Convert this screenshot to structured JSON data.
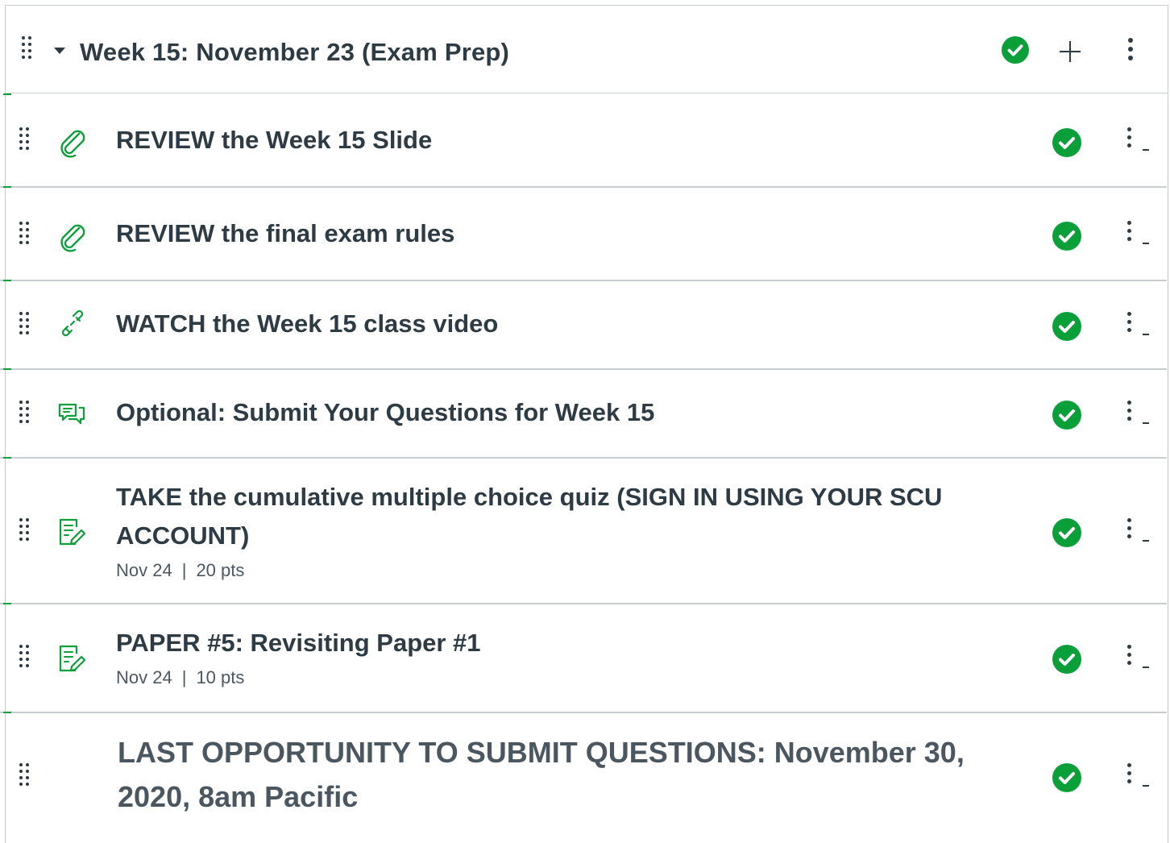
{
  "module": {
    "title": "Week 15: November 23 (Exam Prep)",
    "published": true,
    "collapse_icon": "caret-down-icon",
    "add_icon": "plus-icon",
    "menu_icon": "kebab-icon"
  },
  "items": [
    {
      "type": "file",
      "icon": "paperclip-icon",
      "title": "REVIEW the Week 15 Slide",
      "published": true
    },
    {
      "type": "file",
      "icon": "paperclip-icon",
      "title": "REVIEW the final exam rules",
      "published": true
    },
    {
      "type": "link",
      "icon": "link-icon",
      "title": "WATCH the Week 15 class video",
      "published": true
    },
    {
      "type": "discussion",
      "icon": "discussion-icon",
      "title": "Optional: Submit Your Questions for Week 15",
      "published": true
    },
    {
      "type": "assignment",
      "icon": "assignment-icon",
      "title": "TAKE the cumulative multiple choice quiz (SIGN IN USING YOUR SCU ACCOUNT)",
      "due": "Nov 24",
      "separator": "|",
      "points": "20 pts",
      "published": true
    },
    {
      "type": "assignment",
      "icon": "assignment-icon",
      "title": "PAPER #5: Revisiting Paper #1",
      "due": "Nov 24",
      "separator": "|",
      "points": "10 pts",
      "published": true
    },
    {
      "type": "subheader",
      "title": "LAST OPPORTUNITY TO SUBMIT QUESTIONS: November 30, 2020, 8am Pacific",
      "published": true
    }
  ],
  "colors": {
    "accent_green": "#0b9f3a",
    "text": "#2d3b45",
    "border": "#c7cdd1"
  }
}
